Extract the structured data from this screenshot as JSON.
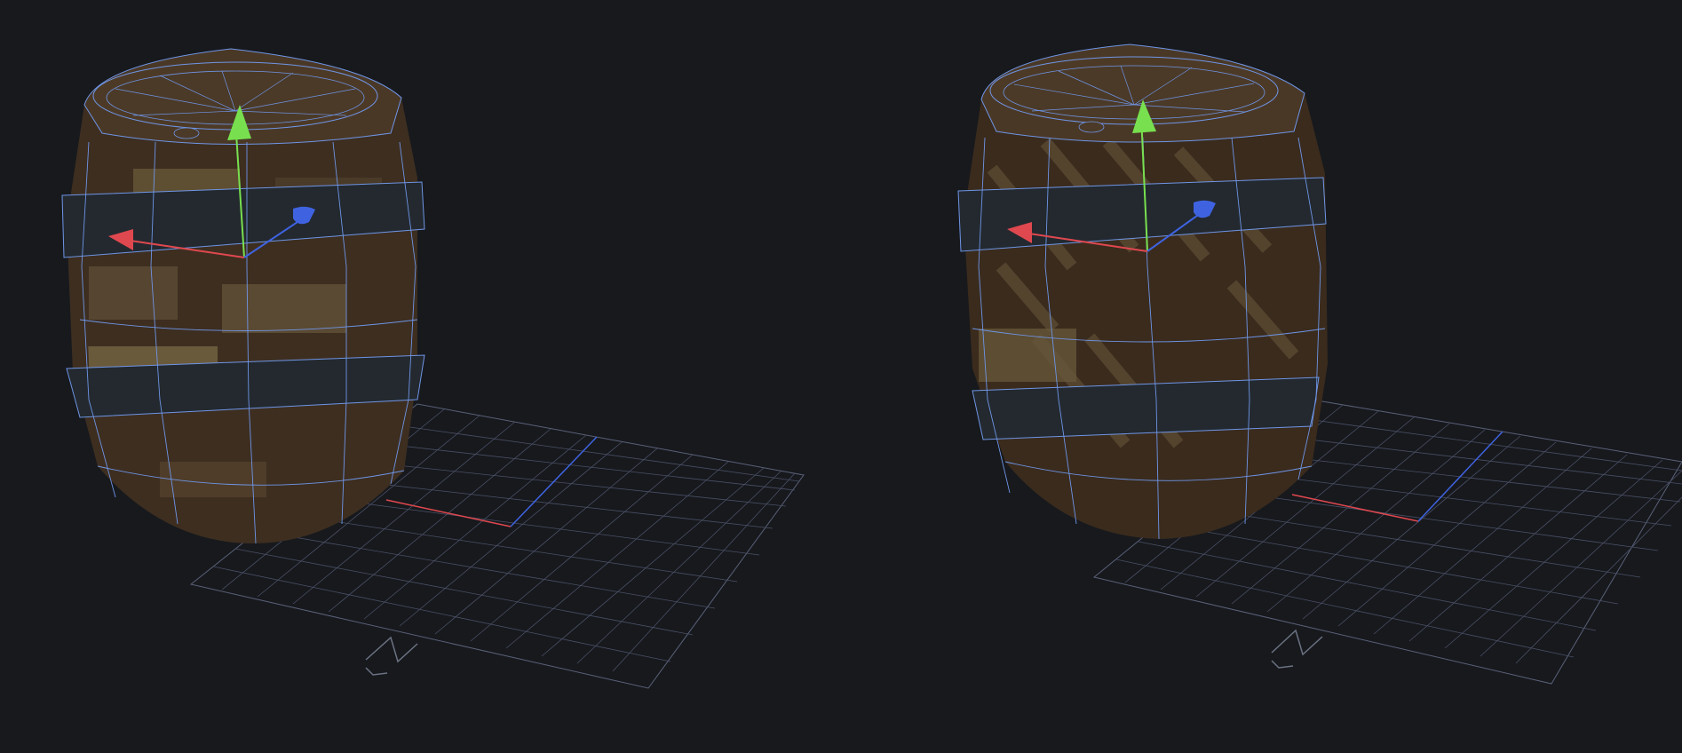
{
  "viewports": [
    {
      "id": "left",
      "object": "barrel",
      "texture": "plank-blocks"
    },
    {
      "id": "right",
      "object": "barrel",
      "texture": "diagonal-grain"
    }
  ],
  "colors": {
    "background": "#17191d",
    "grid": "#5a6178",
    "wireframe": "#6f95e6",
    "x_axis": "#e0484f",
    "y_axis": "#78e04f",
    "z_axis": "#3f63e0",
    "wood_dark": "#3b2c1e",
    "wood_mid": "#4f3d2a",
    "wood_light": "#6a5a3c",
    "metal_band": "#262b30"
  },
  "gizmo": {
    "axes": [
      "x-axis-handle",
      "y-axis-handle",
      "z-axis-handle"
    ]
  },
  "icons": [
    "zoom-zigzag-icon"
  ]
}
